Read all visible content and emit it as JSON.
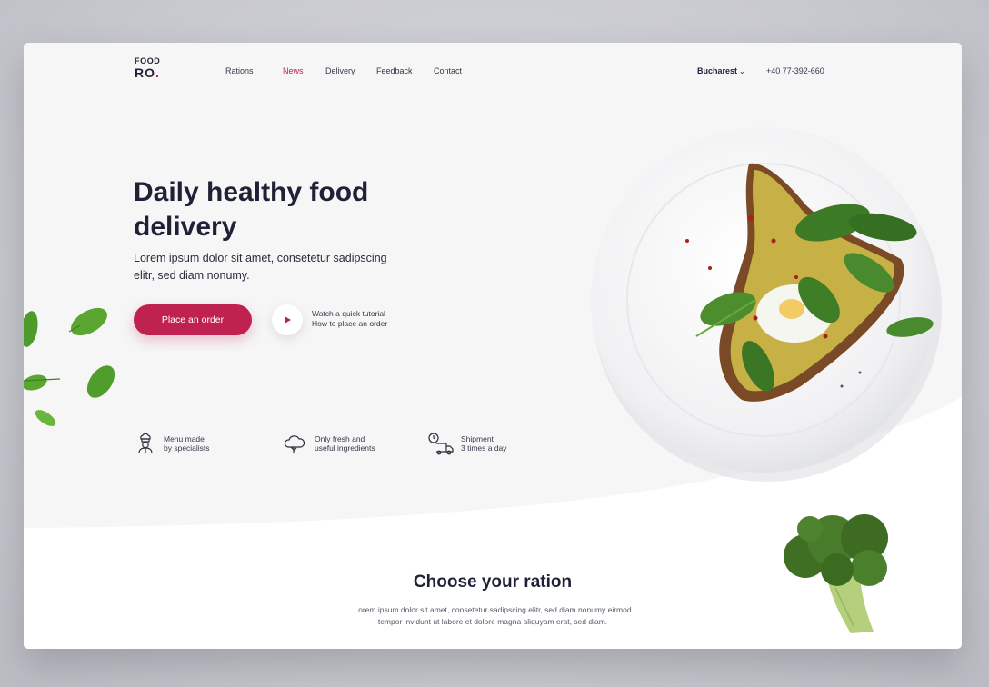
{
  "logo": {
    "line1": "FOOD",
    "line2": "RO",
    "dot": "."
  },
  "nav": [
    {
      "label": "Rations",
      "active": false
    },
    {
      "label": "News",
      "active": true
    },
    {
      "label": "Delivery",
      "active": false
    },
    {
      "label": "Feedback",
      "active": false
    },
    {
      "label": "Contact",
      "active": false
    }
  ],
  "header": {
    "city": "Bucharest",
    "city_chevron": "⌄",
    "phone": "+40 77-392-660"
  },
  "hero": {
    "title_line1": "Daily healthy food",
    "title_line2": "delivery",
    "subtitle_line1": "Lorem ipsum dolor sit amet, consetetur sadipscing",
    "subtitle_line2": "elitr, sed diam nonumy.",
    "cta_label": "Place an order",
    "tutorial_line1": "Watch a quick tutorial",
    "tutorial_line2": "How to place an order"
  },
  "features": [
    {
      "icon": "chef-icon",
      "line1": "Menu made",
      "line2": "by specialists"
    },
    {
      "icon": "cloud-icon",
      "line1": "Only fresh and",
      "line2": "useful ingredients"
    },
    {
      "icon": "delivery-truck-icon",
      "line1": "Shipment",
      "line2": "3 times a day"
    }
  ],
  "ration": {
    "title": "Choose your ration",
    "text_line1": "Lorem ipsum dolor sit amet, consetetur sadipscing elitr, sed diam nonumy eirmod",
    "text_line2": "tempor invidunt ut labore et dolore magna aliquyam erat, sed diam."
  },
  "colors": {
    "accent": "#c0224f",
    "text_dark": "#1f2236",
    "card_bg": "#f6f6f7"
  }
}
